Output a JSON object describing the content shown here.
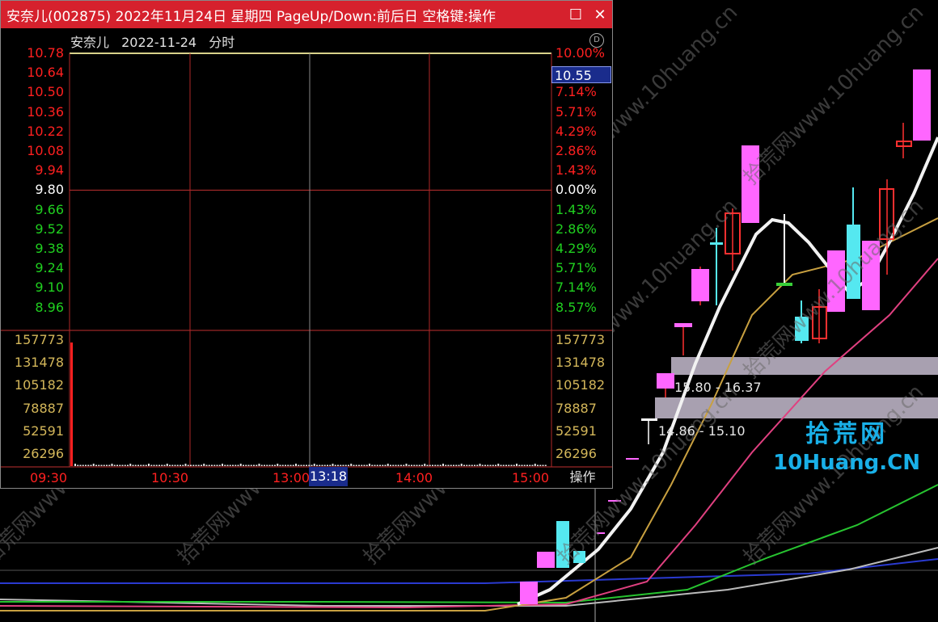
{
  "window": {
    "title": "安奈儿(002875) 2022年11月24日 星期四 PageUp/Down:前后日 空格键:操作",
    "minimize_glyph": "☐",
    "close_glyph": "✕"
  },
  "subheader": {
    "name": "安奈儿",
    "date": "2022-11-24",
    "kind": "分时"
  },
  "current_price": "10.55",
  "cursor_time": "13:18",
  "operate_label": "操作",
  "background": {
    "zone_labels": [
      "15.80 - 16.37",
      "14.86 - 15.10"
    ],
    "brand_cn": "拾荒网",
    "brand_en": "10Huang.CN",
    "watermark_text": "拾荒网www.10huang.cn"
  },
  "colors": {
    "up": "#ff2020",
    "down": "#20d020",
    "flat": "#ffffff",
    "volume": "#d4b75a",
    "titlebar": "#d6212d"
  },
  "chart_data": {
    "type": "line",
    "title": "",
    "price_ticks": [
      "10.78",
      "10.64",
      "10.50",
      "10.36",
      "10.22",
      "10.08",
      "9.94",
      "9.80",
      "9.66",
      "9.52",
      "9.38",
      "9.24",
      "9.10",
      "8.96"
    ],
    "pct_ticks": [
      "10.00%",
      "8.57%",
      "7.14%",
      "5.71%",
      "4.29%",
      "2.86%",
      "1.43%",
      "0.00%",
      "1.43%",
      "2.86%",
      "4.29%",
      "5.71%",
      "7.14%",
      "8.57%"
    ],
    "volume_ticks": [
      "157773",
      "131478",
      "105182",
      "78887",
      "52591",
      "26296"
    ],
    "time_ticks": [
      "09:30",
      "10:30",
      "13:00",
      "14:00",
      "15:00"
    ],
    "prev_close": 9.8,
    "price_line_value": 10.78,
    "ylim": [
      8.89,
      10.78
    ]
  }
}
